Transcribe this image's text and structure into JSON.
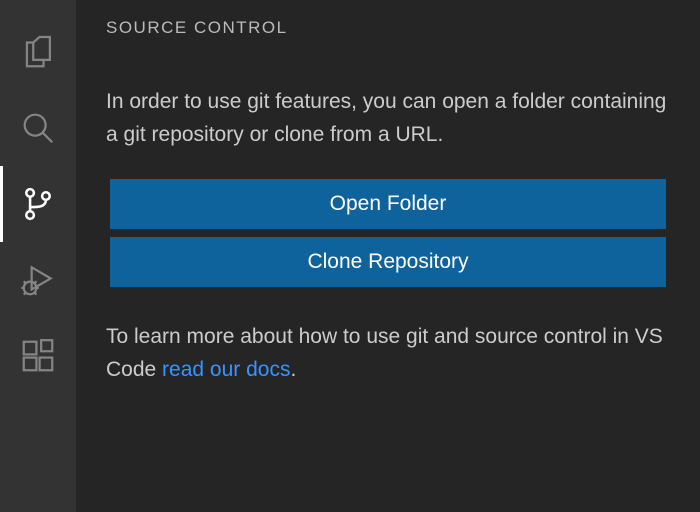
{
  "activityBar": {
    "items": [
      {
        "name": "explorer",
        "active": false
      },
      {
        "name": "search",
        "active": false
      },
      {
        "name": "source-control",
        "active": true
      },
      {
        "name": "run-debug",
        "active": false
      },
      {
        "name": "extensions",
        "active": false
      }
    ]
  },
  "panel": {
    "title": "SOURCE CONTROL",
    "welcome_text": "In order to use git features, you can open a folder containing a git repository or clone from a URL.",
    "open_folder_label": "Open Folder",
    "clone_repo_label": "Clone Repository",
    "learn_prefix": "To learn more about how to use git and source control in VS Code ",
    "learn_link_text": "read our docs",
    "learn_suffix": "."
  },
  "colors": {
    "accent": "#0e639c",
    "link": "#3794ff"
  }
}
